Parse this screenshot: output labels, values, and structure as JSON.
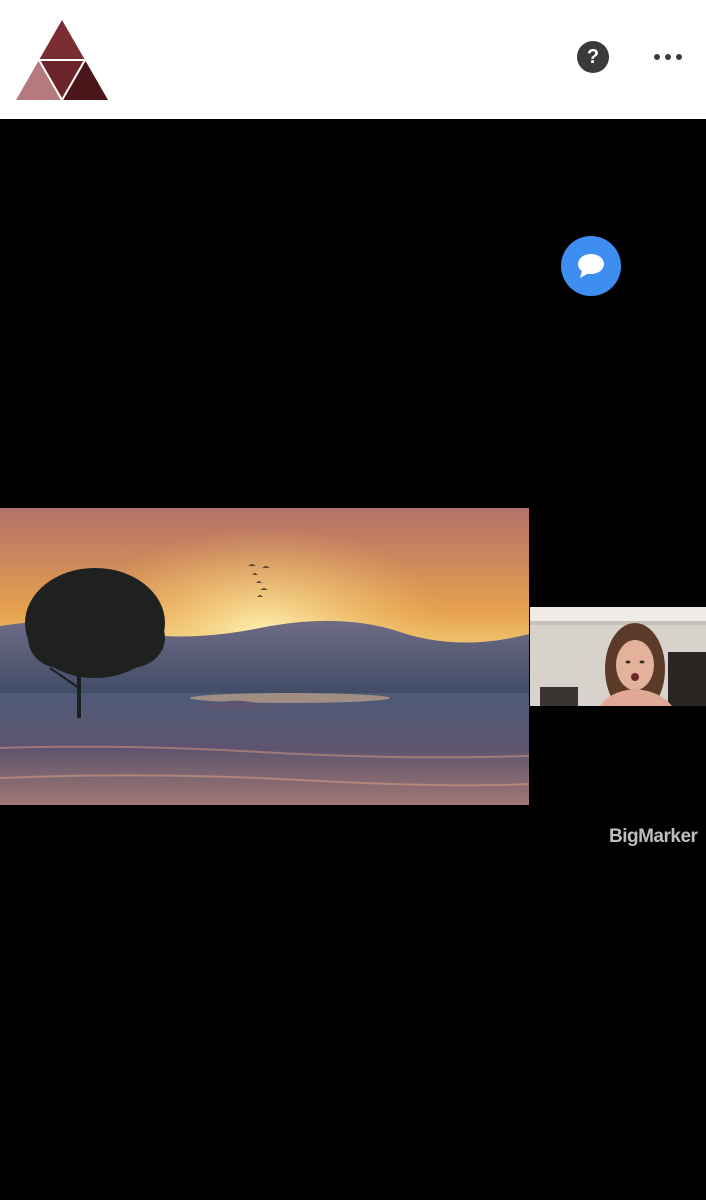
{
  "header": {
    "logo_icon": "triangle-logo-icon",
    "help_label": "?",
    "help_icon": "question-circle-icon",
    "more_icon": "more-dots-icon"
  },
  "stage": {
    "chat_icon": "chat-bubble-icon",
    "chat_color": "#3d8ef0",
    "slide_image": "sunset-lake-tree-image",
    "presenter_video": "presenter-webcam-video",
    "watermark": "BigMarker"
  },
  "colors": {
    "background": "#000000",
    "header_bg": "#ffffff",
    "logo_dark": "#5a1e22",
    "logo_mid": "#7a2d33",
    "logo_light": "#b57a7d"
  }
}
